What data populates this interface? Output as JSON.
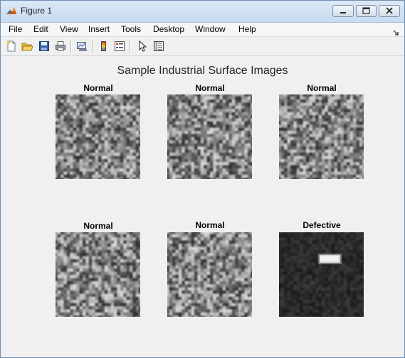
{
  "window": {
    "title": "Figure 1"
  },
  "menu": {
    "items": [
      {
        "label": "File"
      },
      {
        "label": "Edit"
      },
      {
        "label": "View"
      },
      {
        "label": "Insert"
      },
      {
        "label": "Tools"
      },
      {
        "label": "Desktop"
      },
      {
        "label": "Window"
      },
      {
        "label": "Help"
      }
    ]
  },
  "toolbar": {
    "icons": [
      "new-figure-icon",
      "open-file-icon",
      "save-icon",
      "print-icon",
      "link-plot-icon",
      "insert-colorbar-icon",
      "insert-legend-icon",
      "edit-plot-icon",
      "property-inspector-icon"
    ]
  },
  "figure": {
    "title": "Sample Industrial Surface Images",
    "images": [
      {
        "label": "Normal",
        "defective": false
      },
      {
        "label": "Normal",
        "defective": false
      },
      {
        "label": "Normal",
        "defective": false
      },
      {
        "label": "Normal",
        "defective": false
      },
      {
        "label": "Normal",
        "defective": false
      },
      {
        "label": "Defective",
        "defective": true
      }
    ]
  }
}
